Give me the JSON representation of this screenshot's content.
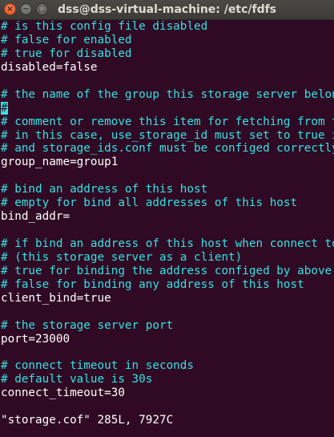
{
  "window": {
    "title": "dss@dss-virtual-machine: /etc/fdfs",
    "close_glyph": "×",
    "minimize_glyph": "−",
    "maximize_glyph": "□"
  },
  "colors": {
    "background": "#300a24",
    "comment": "#34e2e2",
    "text": "#ffffff"
  },
  "terminal": {
    "lines": [
      {
        "type": "comment",
        "text": "# is this config file disabled"
      },
      {
        "type": "comment",
        "text": "# false for enabled"
      },
      {
        "type": "comment",
        "text": "# true for disabled"
      },
      {
        "type": "setting",
        "text": "disabled=false"
      },
      {
        "type": "blank",
        "text": ""
      },
      {
        "type": "comment",
        "text": "# the name of the group this storage server belongs to"
      },
      {
        "type": "cursor",
        "text": "#"
      },
      {
        "type": "comment",
        "text": "# comment or remove this item for fetching from tracker server,"
      },
      {
        "type": "comment",
        "text": "# in this case, use_storage_id must set to true in tracker.conf,"
      },
      {
        "type": "comment",
        "text": "# and storage_ids.conf must be configed correctly."
      },
      {
        "type": "setting",
        "text": "group_name=group1"
      },
      {
        "type": "blank",
        "text": ""
      },
      {
        "type": "comment",
        "text": "# bind an address of this host"
      },
      {
        "type": "comment",
        "text": "# empty for bind all addresses of this host"
      },
      {
        "type": "setting",
        "text": "bind_addr="
      },
      {
        "type": "blank",
        "text": ""
      },
      {
        "type": "comment",
        "text": "# if bind an address of this host when connect to other servers"
      },
      {
        "type": "comment",
        "text": "# (this storage server as a client)"
      },
      {
        "type": "comment",
        "text": "# true for binding the address configed by above parameter: \"bind_addr\""
      },
      {
        "type": "comment",
        "text": "# false for binding any address of this host"
      },
      {
        "type": "setting",
        "text": "client_bind=true"
      },
      {
        "type": "blank",
        "text": ""
      },
      {
        "type": "comment",
        "text": "# the storage server port"
      },
      {
        "type": "setting",
        "text": "port=23000"
      },
      {
        "type": "blank",
        "text": ""
      },
      {
        "type": "comment",
        "text": "# connect timeout in seconds"
      },
      {
        "type": "comment",
        "text": "# default value is 30s"
      },
      {
        "type": "setting",
        "text": "connect_timeout=30"
      },
      {
        "type": "blank",
        "text": ""
      },
      {
        "type": "status",
        "text": "\"storage.cof\" 285L, 7927C"
      }
    ]
  }
}
